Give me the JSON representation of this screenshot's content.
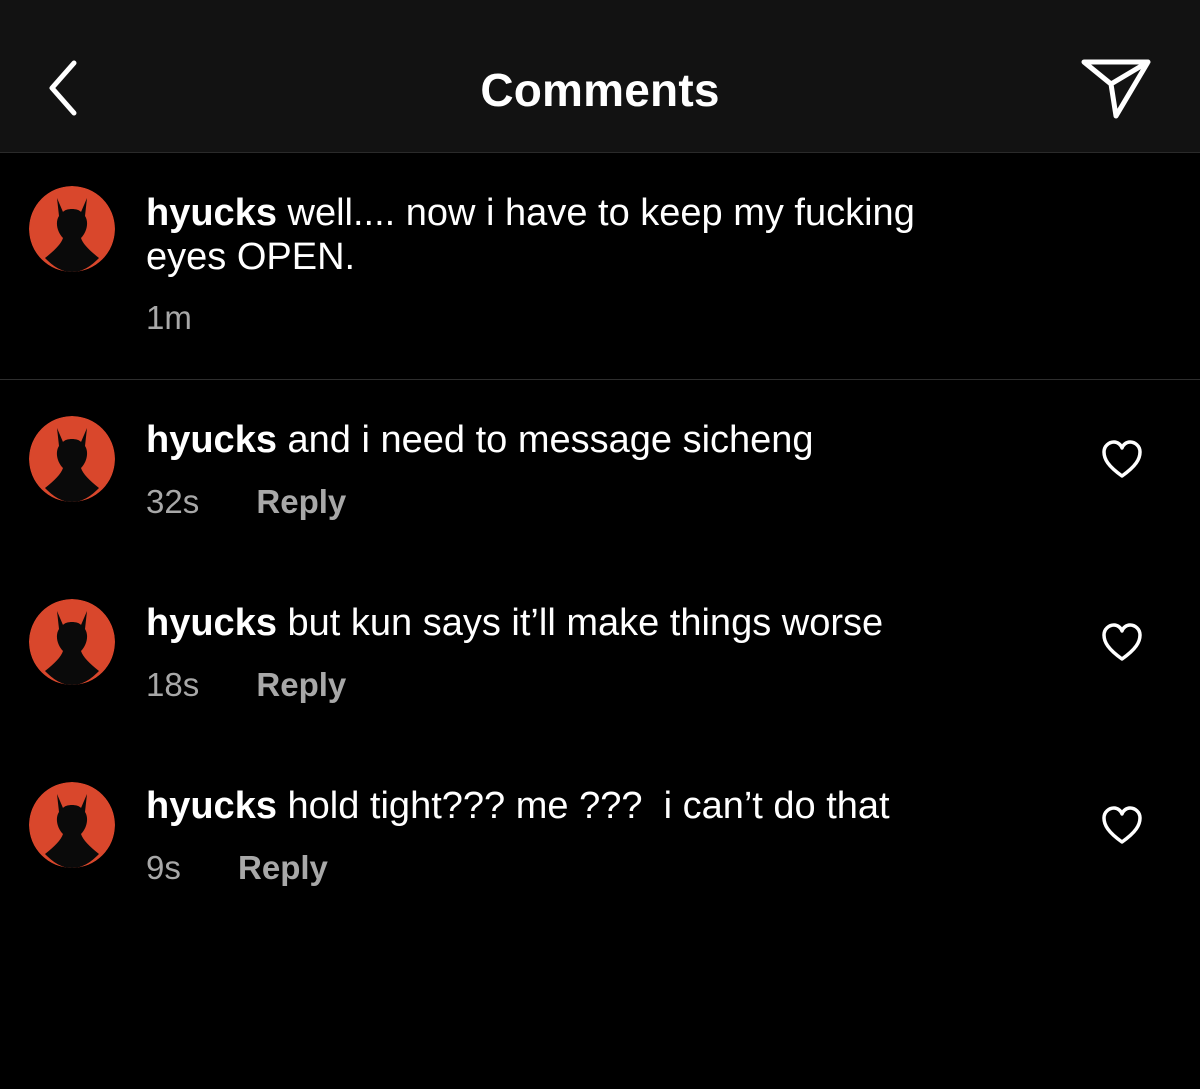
{
  "header": {
    "title": "Comments",
    "back_icon": "chevron-left-icon",
    "share_icon": "paper-plane-icon"
  },
  "colors": {
    "background": "#000000",
    "header_background": "#121212",
    "secondary_text": "#a8a8a8",
    "avatar": "#d9472c"
  },
  "caption": {
    "username": "hyucks",
    "text_line1": "well.... now i have to keep my fucking",
    "text_line2": "eyes OPEN.",
    "time": "1m"
  },
  "comments": [
    {
      "username": "hyucks",
      "text": "and i need to message sicheng",
      "time": "32s",
      "reply_label": "Reply"
    },
    {
      "username": "hyucks",
      "text": "but kun says it’ll make things worse",
      "time": "18s",
      "reply_label": "Reply"
    },
    {
      "username": "hyucks",
      "text": "hold tight??? me ???  i can’t do that",
      "time": "9s",
      "reply_label": "Reply"
    }
  ]
}
